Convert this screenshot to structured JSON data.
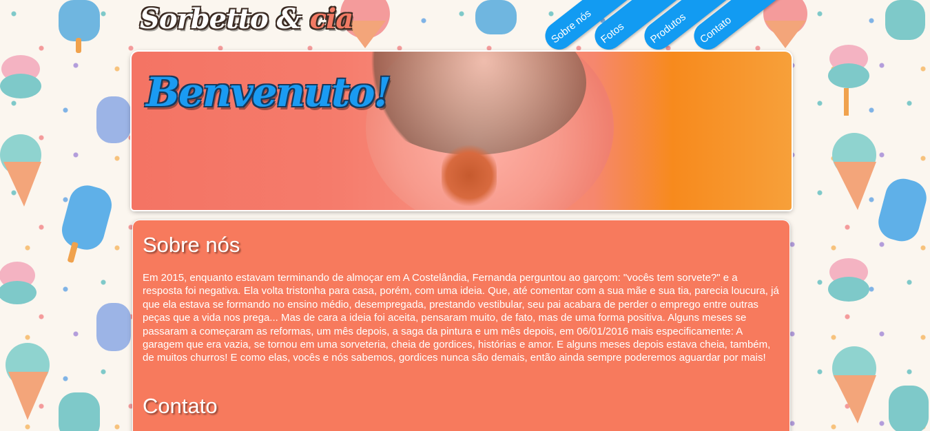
{
  "header": {
    "logo_main": "Sorbetto & ",
    "logo_accent": "cia"
  },
  "nav": {
    "items": [
      {
        "label": "Sobre nós"
      },
      {
        "label": "Fotos"
      },
      {
        "label": "Produtos"
      },
      {
        "label": "Contato"
      }
    ]
  },
  "hero": {
    "title": "Benvenuto!"
  },
  "about": {
    "title": "Sobre nós",
    "text": "Em 2015, enquanto estavam terminando de almoçar em A Costelândia, Fernanda perguntou ao garçom: \"vocês tem sorvete?\" e a resposta foi negativa. Ela volta tristonha para casa, porém, com uma ideia. Que, até comentar com a sua mãe e sua tia, parecia loucura, já que ela estava se formando no ensino médio, desempregada, prestando vestibular, seu pai acabara de perder o emprego entre outras peças que a vida nos prega... Mas de cara a ideia foi aceita, pensaram muito, de fato, mas de uma forma positiva. Alguns meses se passaram a começaram as reformas, um mês depois, a saga da pintura e um mês depois, em 06/01/2016 mais especificamente: A garagem que era vazia, se tornou em uma sorveteria, cheia de gordices, histórias e amor. E alguns meses depois estava cheia, também, de muitos churros! E como elas, vocês e nós sabemos, gordices nunca são demais, então ainda sempre poderemos aguardar por mais!"
  },
  "contact": {
    "title": "Contato"
  },
  "colors": {
    "nav_blue": "#129bf2",
    "panel_coral": "#f77a5d",
    "hero_title_blue": "#1a9bf2",
    "logo_accent": "#f27a64"
  }
}
